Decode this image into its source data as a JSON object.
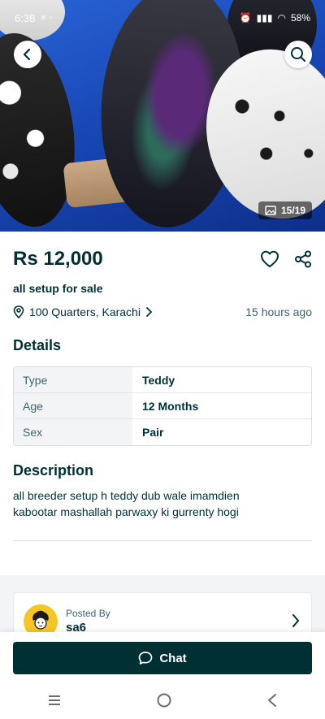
{
  "status_bar": {
    "time": "6:38",
    "battery": "58%"
  },
  "gallery": {
    "counter": "15/19"
  },
  "listing": {
    "price": "Rs 12,000",
    "title": "all setup for sale",
    "location": "100 Quarters, Karachi",
    "posted_time": "15 hours ago"
  },
  "details": {
    "heading": "Details",
    "rows": [
      {
        "key": "Type",
        "value": "Teddy"
      },
      {
        "key": "Age",
        "value": "12 Months"
      },
      {
        "key": "Sex",
        "value": "Pair"
      }
    ]
  },
  "description": {
    "heading": "Description",
    "text": "all breeder setup h teddy dub wale imamdien\n kabootar mashallah parwaxy ki gurrenty hogi"
  },
  "seller": {
    "posted_by_label": "Posted By",
    "name": "sa6"
  },
  "actions": {
    "chat_label": "Chat"
  },
  "colors": {
    "primary": "#002f34",
    "avatar_bg": "#f6c624",
    "muted_text": "#406367"
  },
  "icons": {
    "back": "chevron-left-icon",
    "search": "search-icon",
    "gallery": "image-icon",
    "favorite": "heart-icon",
    "share": "share-icon",
    "location": "location-pin-icon",
    "chat": "chat-bubble-icon"
  }
}
